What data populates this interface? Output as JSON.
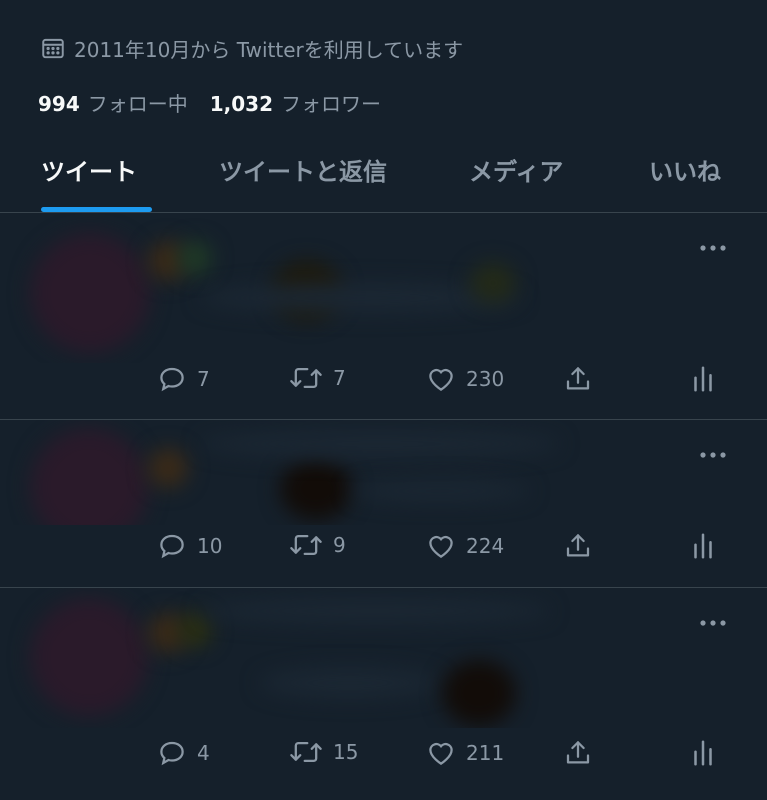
{
  "profile": {
    "joined_text": "2011年10月から Twitterを利用しています",
    "following_count": "994",
    "following_label": "フォロー中",
    "followers_count": "1,032",
    "followers_label": "フォロワー"
  },
  "tabs": [
    {
      "label": "ツイート",
      "active": true
    },
    {
      "label": "ツイートと返信",
      "active": false
    },
    {
      "label": "メディア",
      "active": false
    },
    {
      "label": "いいね",
      "active": false
    }
  ],
  "tweets": [
    {
      "replies": "7",
      "retweets": "7",
      "likes": "230"
    },
    {
      "replies": "10",
      "retweets": "9",
      "likes": "224"
    },
    {
      "replies": "4",
      "retweets": "15",
      "likes": "211"
    }
  ],
  "colors": {
    "background": "#15202b",
    "primary_text": "#f7f9f9",
    "secondary_text": "#8b98a5",
    "accent": "#1d9bf0",
    "divider": "#38444d"
  },
  "icons": [
    "calendar-icon",
    "more-icon",
    "reply-icon",
    "retweet-icon",
    "like-icon",
    "share-icon",
    "analytics-icon"
  ]
}
